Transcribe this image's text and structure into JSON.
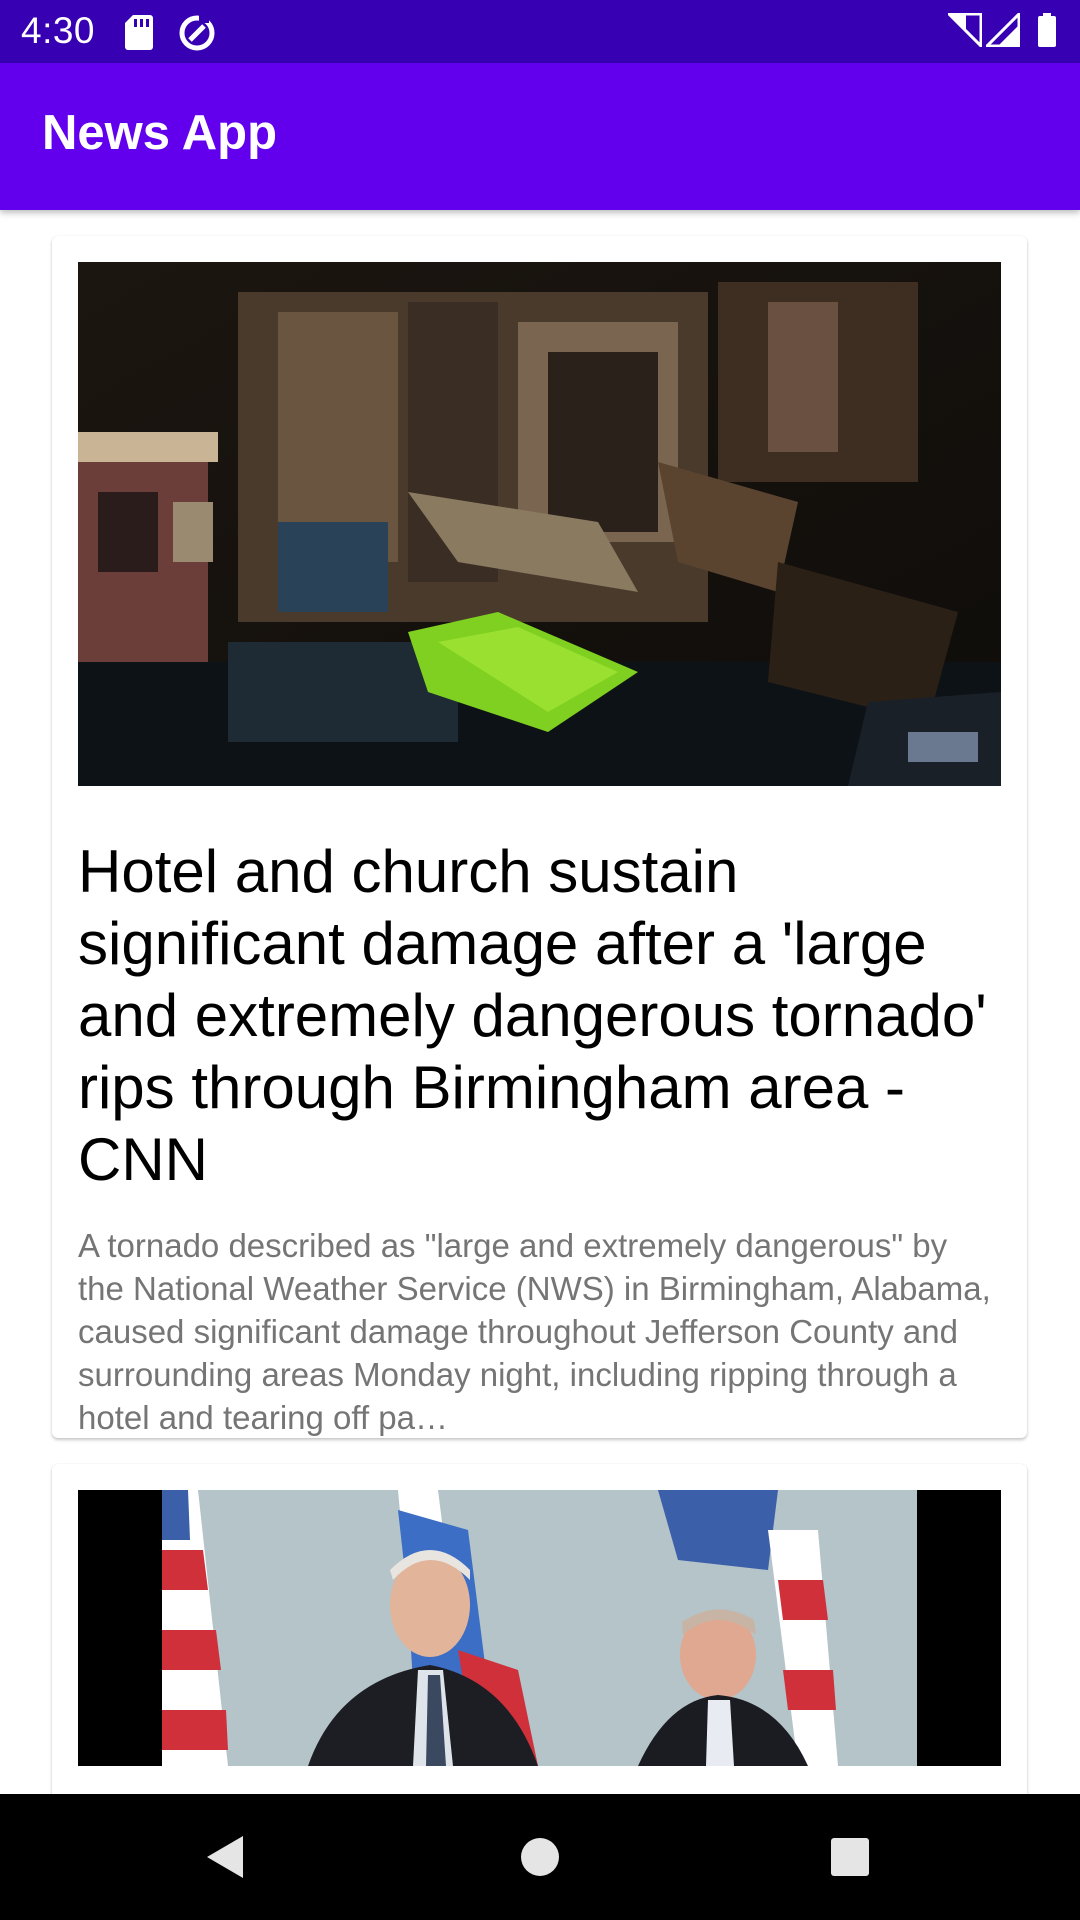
{
  "status_bar": {
    "time": "4:30",
    "icons": [
      "sd-card-icon",
      "data-saver-icon",
      "wifi-icon",
      "signal-icon",
      "battery-icon"
    ],
    "background": "#3700b3"
  },
  "app_bar": {
    "title": "News App",
    "background": "#6200ee"
  },
  "articles": [
    {
      "image": "tornado-damage-photo",
      "title": "Hotel and church sustain significant damage after a 'large and extremely dangerous tornado' rips through Birmingham area - CNN",
      "description": "A tornado described as \"large and extremely dangerous\" by the National Weather Service (NWS) in Birmingham, Alabama, caused significant damage throughout Jefferson County and surrounding areas Monday night, including ripping through a hotel and tearing off pa…"
    },
    {
      "image": "leaders-with-flags-photo",
      "title": "",
      "description": ""
    }
  ],
  "nav_bar": {
    "buttons": [
      "back-icon",
      "home-icon",
      "recents-icon"
    ]
  },
  "colors": {
    "primary": "#6200ee",
    "primary_dark": "#3700b3",
    "headline_text": "#000000",
    "description_text": "#757575"
  }
}
